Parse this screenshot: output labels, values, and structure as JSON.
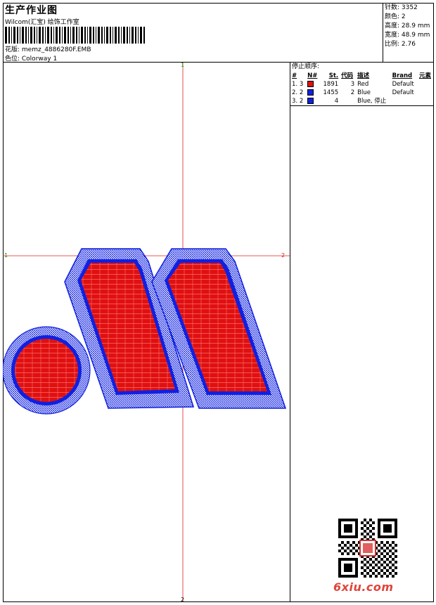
{
  "header": {
    "title": "生产作业图",
    "subtitle": "Wilcom(汇宝) 绘饰工作室",
    "design": "花版: memz_4886280F.EMB",
    "colorway": "色位: Colorway 1"
  },
  "stats": [
    {
      "label": "针数",
      "value": "3352"
    },
    {
      "label": "颜色",
      "value": "2"
    },
    {
      "label": "高度",
      "value": "28.9 mm"
    },
    {
      "label": "宽度",
      "value": "48.9 mm"
    },
    {
      "label": "比例",
      "value": "2.76"
    }
  ],
  "sequence": {
    "title": "停止顺序:",
    "headers": [
      "#",
      "N#",
      "St.",
      "代码",
      "描述",
      "Brand",
      "元素"
    ],
    "rows": [
      {
        "idx": "1.",
        "n": "3",
        "color": "#e01010",
        "st": "1891",
        "code": "3",
        "desc": "Red",
        "brand": "Default"
      },
      {
        "idx": "2.",
        "n": "2",
        "color": "#1020e0",
        "st": "1455",
        "code": "2",
        "desc": "Blue",
        "brand": "Default"
      },
      {
        "idx": "3.",
        "n": "2",
        "color": "#1020e0",
        "st": "4",
        "code": "",
        "desc": "Blue, 停止",
        "brand": ""
      }
    ]
  },
  "axis_labels": {
    "top": "1",
    "bottom": "2",
    "left": "1",
    "right": "2"
  },
  "watermark": "6xiu.com",
  "colors": {
    "red": "#e01010",
    "blue": "#1020e0",
    "axis": "#e02020",
    "axis_label": "#00a000"
  }
}
